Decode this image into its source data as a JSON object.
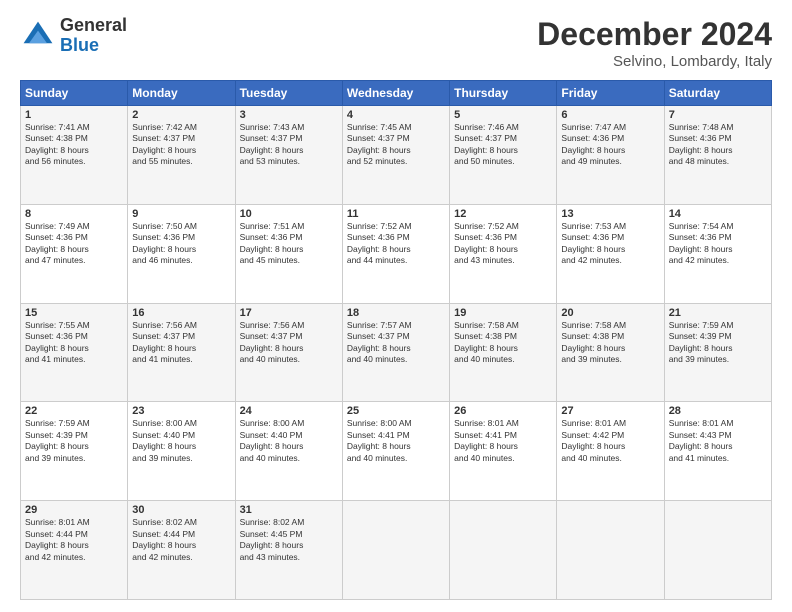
{
  "header": {
    "logo_line1": "General",
    "logo_line2": "Blue",
    "month_year": "December 2024",
    "location": "Selvino, Lombardy, Italy"
  },
  "columns": [
    "Sunday",
    "Monday",
    "Tuesday",
    "Wednesday",
    "Thursday",
    "Friday",
    "Saturday"
  ],
  "weeks": [
    [
      {
        "day": "1",
        "info": "Sunrise: 7:41 AM\nSunset: 4:38 PM\nDaylight: 8 hours\nand 56 minutes."
      },
      {
        "day": "2",
        "info": "Sunrise: 7:42 AM\nSunset: 4:37 PM\nDaylight: 8 hours\nand 55 minutes."
      },
      {
        "day": "3",
        "info": "Sunrise: 7:43 AM\nSunset: 4:37 PM\nDaylight: 8 hours\nand 53 minutes."
      },
      {
        "day": "4",
        "info": "Sunrise: 7:45 AM\nSunset: 4:37 PM\nDaylight: 8 hours\nand 52 minutes."
      },
      {
        "day": "5",
        "info": "Sunrise: 7:46 AM\nSunset: 4:37 PM\nDaylight: 8 hours\nand 50 minutes."
      },
      {
        "day": "6",
        "info": "Sunrise: 7:47 AM\nSunset: 4:36 PM\nDaylight: 8 hours\nand 49 minutes."
      },
      {
        "day": "7",
        "info": "Sunrise: 7:48 AM\nSunset: 4:36 PM\nDaylight: 8 hours\nand 48 minutes."
      }
    ],
    [
      {
        "day": "8",
        "info": "Sunrise: 7:49 AM\nSunset: 4:36 PM\nDaylight: 8 hours\nand 47 minutes."
      },
      {
        "day": "9",
        "info": "Sunrise: 7:50 AM\nSunset: 4:36 PM\nDaylight: 8 hours\nand 46 minutes."
      },
      {
        "day": "10",
        "info": "Sunrise: 7:51 AM\nSunset: 4:36 PM\nDaylight: 8 hours\nand 45 minutes."
      },
      {
        "day": "11",
        "info": "Sunrise: 7:52 AM\nSunset: 4:36 PM\nDaylight: 8 hours\nand 44 minutes."
      },
      {
        "day": "12",
        "info": "Sunrise: 7:52 AM\nSunset: 4:36 PM\nDaylight: 8 hours\nand 43 minutes."
      },
      {
        "day": "13",
        "info": "Sunrise: 7:53 AM\nSunset: 4:36 PM\nDaylight: 8 hours\nand 42 minutes."
      },
      {
        "day": "14",
        "info": "Sunrise: 7:54 AM\nSunset: 4:36 PM\nDaylight: 8 hours\nand 42 minutes."
      }
    ],
    [
      {
        "day": "15",
        "info": "Sunrise: 7:55 AM\nSunset: 4:36 PM\nDaylight: 8 hours\nand 41 minutes."
      },
      {
        "day": "16",
        "info": "Sunrise: 7:56 AM\nSunset: 4:37 PM\nDaylight: 8 hours\nand 41 minutes."
      },
      {
        "day": "17",
        "info": "Sunrise: 7:56 AM\nSunset: 4:37 PM\nDaylight: 8 hours\nand 40 minutes."
      },
      {
        "day": "18",
        "info": "Sunrise: 7:57 AM\nSunset: 4:37 PM\nDaylight: 8 hours\nand 40 minutes."
      },
      {
        "day": "19",
        "info": "Sunrise: 7:58 AM\nSunset: 4:38 PM\nDaylight: 8 hours\nand 40 minutes."
      },
      {
        "day": "20",
        "info": "Sunrise: 7:58 AM\nSunset: 4:38 PM\nDaylight: 8 hours\nand 39 minutes."
      },
      {
        "day": "21",
        "info": "Sunrise: 7:59 AM\nSunset: 4:39 PM\nDaylight: 8 hours\nand 39 minutes."
      }
    ],
    [
      {
        "day": "22",
        "info": "Sunrise: 7:59 AM\nSunset: 4:39 PM\nDaylight: 8 hours\nand 39 minutes."
      },
      {
        "day": "23",
        "info": "Sunrise: 8:00 AM\nSunset: 4:40 PM\nDaylight: 8 hours\nand 39 minutes."
      },
      {
        "day": "24",
        "info": "Sunrise: 8:00 AM\nSunset: 4:40 PM\nDaylight: 8 hours\nand 40 minutes."
      },
      {
        "day": "25",
        "info": "Sunrise: 8:00 AM\nSunset: 4:41 PM\nDaylight: 8 hours\nand 40 minutes."
      },
      {
        "day": "26",
        "info": "Sunrise: 8:01 AM\nSunset: 4:41 PM\nDaylight: 8 hours\nand 40 minutes."
      },
      {
        "day": "27",
        "info": "Sunrise: 8:01 AM\nSunset: 4:42 PM\nDaylight: 8 hours\nand 40 minutes."
      },
      {
        "day": "28",
        "info": "Sunrise: 8:01 AM\nSunset: 4:43 PM\nDaylight: 8 hours\nand 41 minutes."
      }
    ],
    [
      {
        "day": "29",
        "info": "Sunrise: 8:01 AM\nSunset: 4:44 PM\nDaylight: 8 hours\nand 42 minutes."
      },
      {
        "day": "30",
        "info": "Sunrise: 8:02 AM\nSunset: 4:44 PM\nDaylight: 8 hours\nand 42 minutes."
      },
      {
        "day": "31",
        "info": "Sunrise: 8:02 AM\nSunset: 4:45 PM\nDaylight: 8 hours\nand 43 minutes."
      },
      {
        "day": "",
        "info": ""
      },
      {
        "day": "",
        "info": ""
      },
      {
        "day": "",
        "info": ""
      },
      {
        "day": "",
        "info": ""
      }
    ]
  ]
}
